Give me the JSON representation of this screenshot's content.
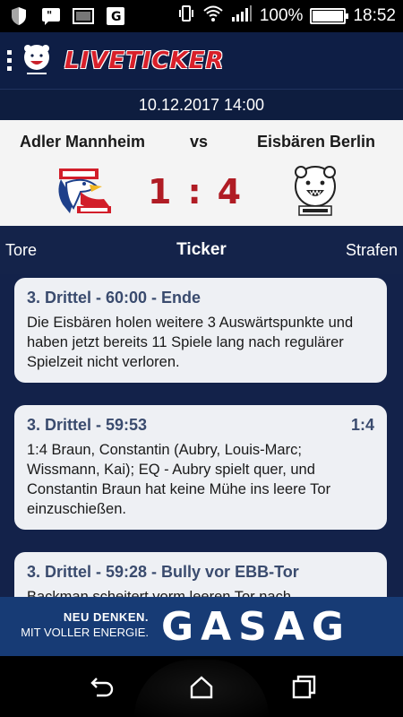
{
  "status_bar": {
    "battery_text": "100%",
    "time": "18:52",
    "battery_level": 1.0
  },
  "header": {
    "title": "LIVETICKER"
  },
  "match": {
    "datetime": "10.12.2017 14:00",
    "home_team": "Adler Mannheim",
    "vs": "vs",
    "away_team": "Eisbären Berlin",
    "score_home": "1",
    "score_sep": ":",
    "score_away": "4"
  },
  "tabs": {
    "left": "Tore",
    "middle": "Ticker",
    "right": "Strafen"
  },
  "ticker": [
    {
      "head": "3. Drittel - 60:00 - Ende",
      "score": "",
      "text": "Die Eisbären holen weitere 3 Auswärtspunkte und haben jetzt bereits 11 Spiele lang nach regulärer Spielzeit nicht verloren."
    },
    {
      "head": "3. Drittel - 59:53",
      "score": "1:4",
      "text": "1:4 Braun, Constantin (Aubry, Louis-Marc; Wissmann, Kai); EQ - Aubry spielt quer, und Constantin Braun hat keine Mühe ins leere Tor einzuschießen."
    },
    {
      "head": "3. Drittel - 59:28 - Bully vor EBB-Tor",
      "score": "",
      "text": "Backman scheitert vorm leeren Tor nach"
    }
  ],
  "ad": {
    "line1": "NEU DENKEN.",
    "line2": "MIT VOLLER ENERGIE.",
    "brand": "GASAG"
  },
  "colors": {
    "header_bg": "#0e1e45",
    "title_red": "#d8202a",
    "score_red": "#b01c24",
    "ticker_bg": "#13224a",
    "card_bg": "#eef0f4",
    "ad_bg": "#173b75"
  }
}
